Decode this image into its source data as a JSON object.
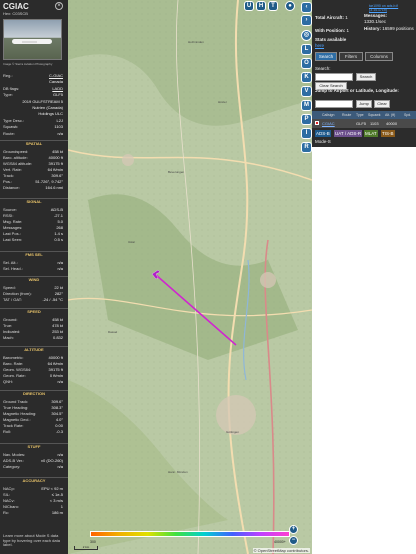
{
  "left": {
    "title": "CGIAC",
    "hex": "Hex: C03SCB",
    "photo_credit": "Image © Sierra Aviation Photography",
    "reg_label": "Reg.:",
    "reg_value": "C-GIAC",
    "country": "Canada",
    "dbflags_label": "DB flags:",
    "dbflags_value": "LADD",
    "type_label": "Type:",
    "type_value": "GLF5",
    "model": "2019 GULFSTREAM 5",
    "owner1": "Nutrien (Canada)",
    "owner2": "Holdings ULC",
    "typedesc_label": "Type Desc.:",
    "typedesc_value": "L2J",
    "squawk_label": "Squawk:",
    "squawk_value": "1103",
    "route_label": "Route:",
    "route_value": "n/a",
    "spatial_title": "SPATIAL",
    "spatial": [
      [
        "Groundspeed:",
        "458 kt"
      ],
      [
        "Baro. altitude:",
        "40000 ft"
      ],
      [
        "WGS84 altitude:",
        "39175 ft"
      ],
      [
        "Vert. Rate:",
        "64 ft/min"
      ],
      [
        "Track:",
        "309.6°"
      ],
      [
        "Pos.:",
        "51.726°, 9.742°"
      ],
      [
        "Distance:",
        "164.6 nmi"
      ]
    ],
    "signal_title": "SIGNAL",
    "signal": [
      [
        "Source:",
        "ADS-B"
      ],
      [
        "RSSI:",
        "-27.1"
      ],
      [
        "Msg. Rate:",
        "5.0"
      ],
      [
        "Messages:",
        "268"
      ],
      [
        "Last Pos.:",
        "1.4 s"
      ],
      [
        "Last Seen:",
        "0.5 s"
      ]
    ],
    "fmssel_title": "FMS SEL",
    "fmssel": [
      [
        "Sel. Alt.:",
        "n/a"
      ],
      [
        "Sel. Head.:",
        "n/a"
      ]
    ],
    "wind_title": "WIND",
    "wind": [
      [
        "Speed:",
        "22 kt"
      ],
      [
        "Direction (from):",
        "282°"
      ],
      [
        "TAT / OAT:",
        "-24 / -54 °C"
      ]
    ],
    "speed_title": "SPEED",
    "speed": [
      [
        "Ground:",
        "458 kt"
      ],
      [
        "True:",
        "478 kt"
      ],
      [
        "Indicated:",
        "253 kt"
      ],
      [
        "Mach:",
        "0.832"
      ]
    ],
    "altitude_title": "ALTITUDE",
    "altitude": [
      [
        "Barometric:",
        "40000 ft"
      ],
      [
        "Baro. Rate:",
        "64 ft/min"
      ],
      [
        "Geom. WGS84:",
        "39175 ft"
      ],
      [
        "Geom. Rate:",
        "0 ft/min"
      ],
      [
        "QNH:",
        "n/a"
      ]
    ],
    "direction_title": "DIRECTION",
    "direction": [
      [
        "Ground Track:",
        "309.6°"
      ],
      [
        "True Heading:",
        "308.3°"
      ],
      [
        "Magnetic Heading:",
        "304.5°"
      ],
      [
        "Magnetic Decl.:",
        "4.0°"
      ],
      [
        "Track Rate:",
        "0.00"
      ],
      [
        "Roll:",
        "-0.3"
      ]
    ],
    "stuff_title": "STUFF",
    "stuff": [
      [
        "Nav. Modes:",
        "n/a"
      ],
      [
        "ADS-B Ver.:",
        "v0 (DO-260)"
      ],
      [
        "Category:",
        "n/a"
      ]
    ],
    "accuracy_title": "ACCURACY",
    "accuracy": [
      [
        "NACp:",
        "EPU < 92 m"
      ],
      [
        "SIL:",
        "≤ 1e-5"
      ],
      [
        "NACv:",
        "< 3 m/s"
      ],
      [
        "NICbaro:",
        "1"
      ],
      [
        "Rc:",
        "186 m"
      ]
    ],
    "info": "Learn more about Mode S data type by hovering over each data label."
  },
  "map": {
    "top_buttons": [
      "U",
      "H",
      "T"
    ],
    "side_buttons": [
      "L",
      "O",
      "K",
      "V",
      "M",
      "P",
      "I",
      "R"
    ],
    "zoom_in": "+",
    "zoom_out": "−",
    "attribution": "© OpenStreetMap contributors.",
    "scale": "2 km",
    "legend_labels": [
      "300",
      "",
      "",
      "",
      "",
      "",
      "",
      "40000+"
    ],
    "legend_colors": [
      "#ff6400",
      "#f0b000",
      "#e0e000",
      "#40e040",
      "#00d0d0",
      "#4060ff",
      "#c040ff",
      "#ff40d0"
    ],
    "places": [
      "Holzminden",
      "Höxter",
      "Beverungen",
      "Uslar",
      "Dassel",
      "Göttingen",
      "Hann. Münden"
    ]
  },
  "right": {
    "version": "tar1090 on ads-b.fi (3.14.1719)",
    "total_label": "Total Aircraft:",
    "total_value": "1",
    "pos_label": "With Position:",
    "pos_value": "1",
    "msgs_label": "Messages:",
    "msgs_value": "1330.1/sec",
    "hist_label": "History:",
    "hist_value": "16599 positions",
    "stats": "Stats available",
    "stats_link": "here",
    "tabs": [
      "Search",
      "Filters",
      "Columns"
    ],
    "search_label": "Search:",
    "search_btn": "Search",
    "clear_search": "Clear Search",
    "jump_label": "Jump to Airport or Latitude, Longitude:",
    "jump_btn": "Jump",
    "clear_btn": "Clear",
    "columns": [
      "Callsign",
      "Route",
      "Type",
      "Squawk",
      "Alt. (ft)",
      "Spd."
    ],
    "row": {
      "callsign": "CGIAC",
      "type": "GLF5",
      "squawk": "1103",
      "alt": "40000"
    },
    "badges": [
      {
        "label": "ADS-B",
        "color": "#1e5a8c"
      },
      {
        "label": "UAT / ADS-R",
        "color": "#6c4f8c"
      },
      {
        "label": "MLAT",
        "color": "#4f7a2a"
      },
      {
        "label": "TIS-B",
        "color": "#8a5a1a"
      }
    ],
    "modes": "Mode-S"
  }
}
